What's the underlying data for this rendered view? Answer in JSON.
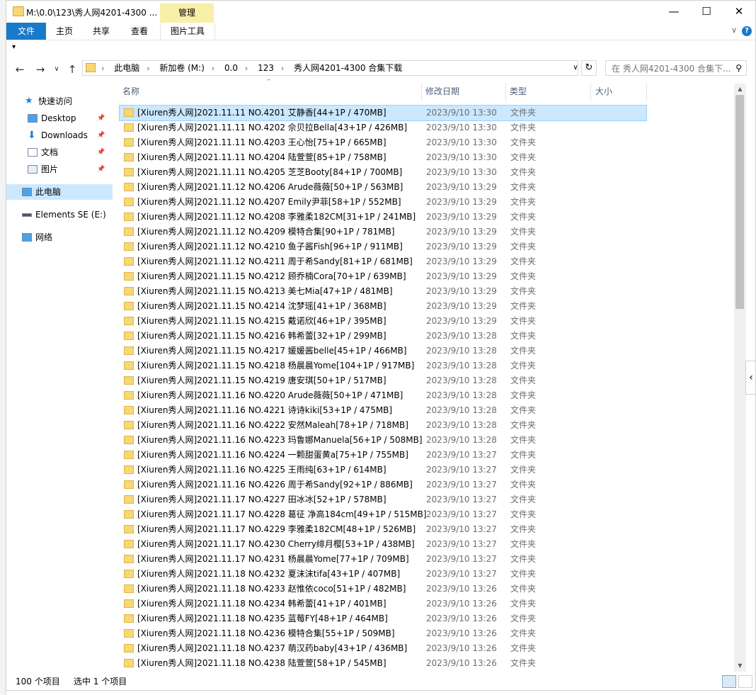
{
  "window": {
    "title": "M:\\0.0\\123\\秀人网4201-4300 ...",
    "context_tab": "管理",
    "minimize": "—",
    "maximize": "☐",
    "close": "✕"
  },
  "ribbon": {
    "tabs": [
      "文件",
      "主页",
      "共享",
      "查看"
    ],
    "context_tab": "图片工具",
    "collapse": "∨",
    "help": "?"
  },
  "qat": "▾",
  "nav": {
    "back": "←",
    "forward": "→",
    "recent": "∨",
    "up": "↑",
    "refresh": "↻",
    "dropdown": "∨"
  },
  "address": {
    "crumbs": [
      "此电脑",
      "新加卷 (M:)",
      "0.0",
      "123",
      "秀人网4201-4300 合集下载"
    ],
    "separator": "›"
  },
  "search": {
    "placeholder": "在 秀人网4201-4300 合集下..."
  },
  "sidebar": {
    "items": [
      {
        "label": "快速访问",
        "icon": "star-icon"
      },
      {
        "label": "Desktop",
        "icon": "desktop-icon",
        "pinned": true
      },
      {
        "label": "Downloads",
        "icon": "download-icon",
        "pinned": true
      },
      {
        "label": "文档",
        "icon": "document-icon",
        "pinned": true
      },
      {
        "label": "图片",
        "icon": "picture-icon",
        "pinned": true
      },
      {
        "label": "此电脑",
        "icon": "computer-icon",
        "selected": true
      },
      {
        "label": "Elements SE (E:)",
        "icon": "drive-icon"
      },
      {
        "label": "网络",
        "icon": "network-icon"
      }
    ]
  },
  "columns": {
    "name": "名称",
    "date": "修改日期",
    "type": "类型",
    "size": "大小"
  },
  "files": [
    {
      "name": "[Xiuren秀人网]2021.11.11 NO.4201 艾静香[44+1P / 470MB]",
      "date": "2023/9/10 13:30",
      "type": "文件夹"
    },
    {
      "name": "[Xiuren秀人网]2021.11.11 NO.4202 佘贝拉Bella[43+1P / 426MB]",
      "date": "2023/9/10 13:30",
      "type": "文件夹"
    },
    {
      "name": "[Xiuren秀人网]2021.11.11 NO.4203 王心怡[75+1P / 665MB]",
      "date": "2023/9/10 13:30",
      "type": "文件夹"
    },
    {
      "name": "[Xiuren秀人网]2021.11.11 NO.4204 陆萱萱[85+1P / 758MB]",
      "date": "2023/9/10 13:30",
      "type": "文件夹"
    },
    {
      "name": "[Xiuren秀人网]2021.11.11 NO.4205 芝芝Booty[84+1P / 700MB]",
      "date": "2023/9/10 13:30",
      "type": "文件夹"
    },
    {
      "name": "[Xiuren秀人网]2021.11.12 NO.4206 Arude薇薇[50+1P / 563MB]",
      "date": "2023/9/10 13:29",
      "type": "文件夹"
    },
    {
      "name": "[Xiuren秀人网]2021.11.12 NO.4207 Emily尹菲[58+1P / 552MB]",
      "date": "2023/9/10 13:29",
      "type": "文件夹"
    },
    {
      "name": "[Xiuren秀人网]2021.11.12 NO.4208 李雅柔182CM[31+1P / 241MB]",
      "date": "2023/9/10 13:29",
      "type": "文件夹"
    },
    {
      "name": "[Xiuren秀人网]2021.11.12 NO.4209 模特合集[90+1P / 781MB]",
      "date": "2023/9/10 13:29",
      "type": "文件夹"
    },
    {
      "name": "[Xiuren秀人网]2021.11.12 NO.4210 鱼子酱Fish[96+1P / 911MB]",
      "date": "2023/9/10 13:29",
      "type": "文件夹"
    },
    {
      "name": "[Xiuren秀人网]2021.11.12 NO.4211 周于希Sandy[81+1P / 681MB]",
      "date": "2023/9/10 13:29",
      "type": "文件夹"
    },
    {
      "name": "[Xiuren秀人网]2021.11.15 NO.4212 顾乔楠Cora[70+1P / 639MB]",
      "date": "2023/9/10 13:29",
      "type": "文件夹"
    },
    {
      "name": "[Xiuren秀人网]2021.11.15 NO.4213 美七Mia[47+1P / 481MB]",
      "date": "2023/9/10 13:29",
      "type": "文件夹"
    },
    {
      "name": "[Xiuren秀人网]2021.11.15 NO.4214 沈梦瑶[41+1P / 368MB]",
      "date": "2023/9/10 13:29",
      "type": "文件夹"
    },
    {
      "name": "[Xiuren秀人网]2021.11.15 NO.4215 戴诺欣[46+1P / 395MB]",
      "date": "2023/9/10 13:29",
      "type": "文件夹"
    },
    {
      "name": "[Xiuren秀人网]2021.11.15 NO.4216 韩希蕾[32+1P / 299MB]",
      "date": "2023/9/10 13:28",
      "type": "文件夹"
    },
    {
      "name": "[Xiuren秀人网]2021.11.15 NO.4217 媛媛酱belle[45+1P / 466MB]",
      "date": "2023/9/10 13:28",
      "type": "文件夹"
    },
    {
      "name": "[Xiuren秀人网]2021.11.15 NO.4218 杨晨晨Yome[104+1P / 917MB]",
      "date": "2023/9/10 13:28",
      "type": "文件夹"
    },
    {
      "name": "[Xiuren秀人网]2021.11.15 NO.4219 唐安琪[50+1P / 517MB]",
      "date": "2023/9/10 13:28",
      "type": "文件夹"
    },
    {
      "name": "[Xiuren秀人网]2021.11.16 NO.4220 Arude薇薇[50+1P / 471MB]",
      "date": "2023/9/10 13:28",
      "type": "文件夹"
    },
    {
      "name": "[Xiuren秀人网]2021.11.16 NO.4221 诗诗kiki[53+1P / 475MB]",
      "date": "2023/9/10 13:28",
      "type": "文件夹"
    },
    {
      "name": "[Xiuren秀人网]2021.11.16 NO.4222 安然Maleah[78+1P / 718MB]",
      "date": "2023/9/10 13:28",
      "type": "文件夹"
    },
    {
      "name": "[Xiuren秀人网]2021.11.16 NO.4223 玛鲁娜Manuela[56+1P / 508MB]",
      "date": "2023/9/10 13:28",
      "type": "文件夹"
    },
    {
      "name": "[Xiuren秀人网]2021.11.16 NO.4224 一颗甜蛋黄a[75+1P / 755MB]",
      "date": "2023/9/10 13:27",
      "type": "文件夹"
    },
    {
      "name": "[Xiuren秀人网]2021.11.16 NO.4225 王雨纯[63+1P / 614MB]",
      "date": "2023/9/10 13:27",
      "type": "文件夹"
    },
    {
      "name": "[Xiuren秀人网]2021.11.16 NO.4226 周于希Sandy[92+1P / 886MB]",
      "date": "2023/9/10 13:27",
      "type": "文件夹"
    },
    {
      "name": "[Xiuren秀人网]2021.11.17 NO.4227 田冰冰[52+1P / 578MB]",
      "date": "2023/9/10 13:27",
      "type": "文件夹"
    },
    {
      "name": "[Xiuren秀人网]2021.11.17 NO.4228 葛征 净高184cm[49+1P / 515MB]",
      "date": "2023/9/10 13:27",
      "type": "文件夹"
    },
    {
      "name": "[Xiuren秀人网]2021.11.17 NO.4229 李雅柔182CM[48+1P / 526MB]",
      "date": "2023/9/10 13:27",
      "type": "文件夹"
    },
    {
      "name": "[Xiuren秀人网]2021.11.17 NO.4230 Cherry绯月樱[53+1P / 438MB]",
      "date": "2023/9/10 13:27",
      "type": "文件夹"
    },
    {
      "name": "[Xiuren秀人网]2021.11.17 NO.4231 杨晨晨Yome[77+1P / 709MB]",
      "date": "2023/9/10 13:27",
      "type": "文件夹"
    },
    {
      "name": "[Xiuren秀人网]2021.11.18 NO.4232 夏沫沫tifa[43+1P / 407MB]",
      "date": "2023/9/10 13:27",
      "type": "文件夹"
    },
    {
      "name": "[Xiuren秀人网]2021.11.18 NO.4233 赵惟依coco[51+1P / 482MB]",
      "date": "2023/9/10 13:26",
      "type": "文件夹"
    },
    {
      "name": "[Xiuren秀人网]2021.11.18 NO.4234 韩希蕾[41+1P / 401MB]",
      "date": "2023/9/10 13:26",
      "type": "文件夹"
    },
    {
      "name": "[Xiuren秀人网]2021.11.18 NO.4235 蓝莓FY[48+1P / 464MB]",
      "date": "2023/9/10 13:26",
      "type": "文件夹"
    },
    {
      "name": "[Xiuren秀人网]2021.11.18 NO.4236 模特合集[55+1P / 509MB]",
      "date": "2023/9/10 13:26",
      "type": "文件夹"
    },
    {
      "name": "[Xiuren秀人网]2021.11.18 NO.4237 萌汉药baby[43+1P / 436MB]",
      "date": "2023/9/10 13:26",
      "type": "文件夹"
    },
    {
      "name": "[Xiuren秀人网]2021.11.18 NO.4238 陆萱萱[58+1P / 545MB]",
      "date": "2023/9/10 13:26",
      "type": "文件夹"
    }
  ],
  "status": {
    "count": "100 个项目",
    "selected": "选中 1 个项目"
  },
  "side_tab": "‹",
  "colors": {
    "accent": "#1979ca",
    "selection": "#cce8ff",
    "folder": "#f8d775",
    "context_tab": "#f8efa8"
  }
}
